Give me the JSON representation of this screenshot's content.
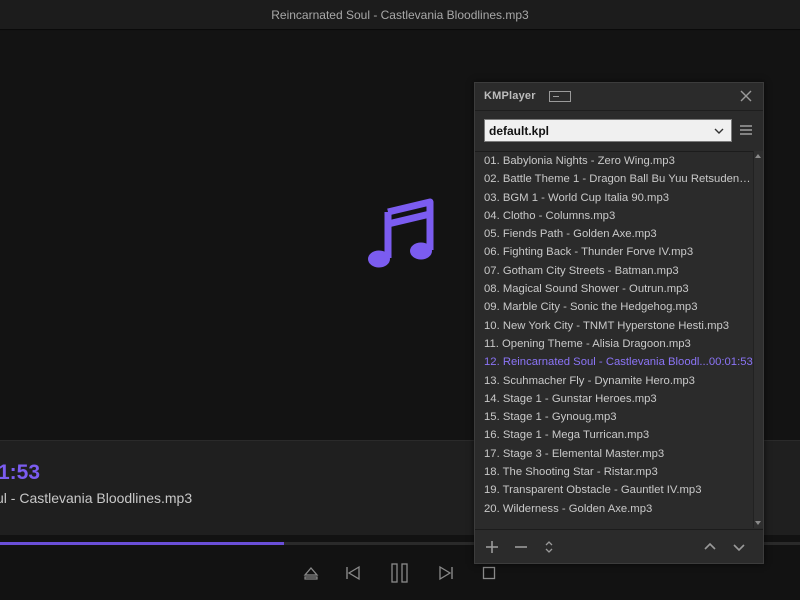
{
  "window": {
    "title": "Reincarnated Soul - Castlevania Bloodlines.mp3"
  },
  "now_playing": {
    "time": "1:53",
    "song": "ul - Castlevania Bloodlines.mp3",
    "progress_fraction": 0.355
  },
  "colors": {
    "accent": "#7b5cf0",
    "now_playing_item": "#8b74f6"
  },
  "icons": {
    "center": "music-note-icon",
    "controls": [
      "eject-icon",
      "previous-icon",
      "pause-icon",
      "next-icon",
      "stop-icon"
    ]
  },
  "playlist": {
    "brand": "KMPlayer",
    "selected_list": "default.kpl",
    "items": [
      {
        "label": "01. Babylonia Nights - Zero Wing.mp3",
        "duration": ""
      },
      {
        "label": "02. Battle Theme 1 - Dragon Ball Bu Yuu Retsuden.mp3",
        "duration": ""
      },
      {
        "label": "03. BGM 1 - World Cup Italia 90.mp3",
        "duration": ""
      },
      {
        "label": "04. Clotho - Columns.mp3",
        "duration": ""
      },
      {
        "label": "05. Fiends Path - Golden Axe.mp3",
        "duration": ""
      },
      {
        "label": "06. Fighting Back - Thunder Forve IV.mp3",
        "duration": ""
      },
      {
        "label": "07. Gotham City Streets - Batman.mp3",
        "duration": ""
      },
      {
        "label": "08. Magical Sound Shower - Outrun.mp3",
        "duration": ""
      },
      {
        "label": "09. Marble City - Sonic the Hedgehog.mp3",
        "duration": ""
      },
      {
        "label": "10. New York City - TNMT Hyperstone Hesti.mp3",
        "duration": ""
      },
      {
        "label": "11. Opening Theme - Alisia Dragoon.mp3",
        "duration": ""
      },
      {
        "label": "12. Reincarnated Soul - Castlevania Bloodl",
        "duration": "...00:01:53",
        "current": true
      },
      {
        "label": "13. Scuhmacher Fly - Dynamite Hero.mp3",
        "duration": ""
      },
      {
        "label": "14. Stage 1 - Gunstar Heroes.mp3",
        "duration": ""
      },
      {
        "label": "15. Stage 1 - Gynoug.mp3",
        "duration": ""
      },
      {
        "label": "16. Stage 1 - Mega Turrican.mp3",
        "duration": ""
      },
      {
        "label": "17. Stage 3 - Elemental Master.mp3",
        "duration": ""
      },
      {
        "label": "18. The Shooting Star - Ristar.mp3",
        "duration": ""
      },
      {
        "label": "19. Transparent Obstacle - Gauntlet IV.mp3",
        "duration": ""
      },
      {
        "label": "20. Wilderness - Golden Axe.mp3",
        "duration": ""
      }
    ],
    "footer_icons": [
      "add-icon",
      "remove-icon",
      "sort-icon",
      "move-up-icon",
      "move-down-icon"
    ]
  }
}
